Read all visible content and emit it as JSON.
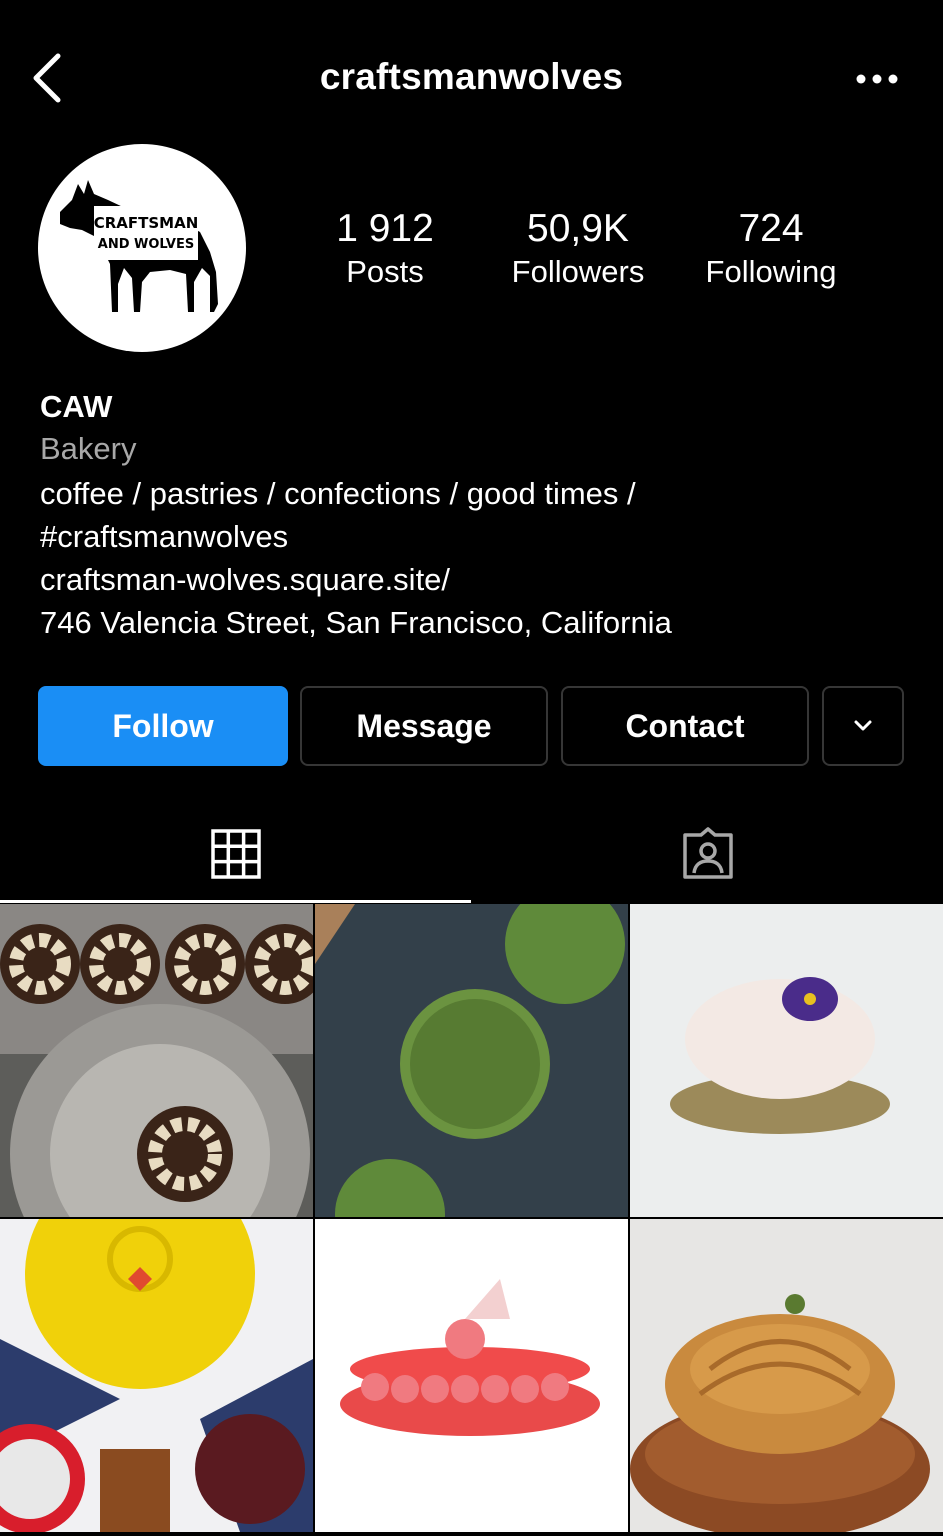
{
  "header": {
    "title": "craftsmanwolves"
  },
  "profile": {
    "logo_text_line1": "CRAFTSMAN",
    "logo_text_line2": "AND WOLVES",
    "stats": [
      {
        "value": "1 912",
        "label": "Posts"
      },
      {
        "value": "50,9K",
        "label": "Followers"
      },
      {
        "value": "724",
        "label": "Following"
      }
    ],
    "name": "CAW",
    "category": "Bakery",
    "bio_line1": "coffee / pastries / confections / good times /",
    "bio_line2": "#craftsmanwolves",
    "link": "craftsman-wolves.square.site/",
    "address": "746 Valencia Street, San Francisco, California"
  },
  "actions": {
    "follow": "Follow",
    "message": "Message",
    "contact": "Contact"
  },
  "tabs": [
    {
      "icon": "grid-icon",
      "active": true
    },
    {
      "icon": "tagged-person-icon",
      "active": false
    }
  ],
  "posts": [
    {
      "subject": "chocolate tart rings with white chocolate twists on a tray"
    },
    {
      "subject": "green pistachio cakes on a slate board"
    },
    {
      "subject": "white mousse dessert with purple violet flower"
    },
    {
      "subject": "yellow glazed cake with heart decorations and tarts"
    },
    {
      "subject": "red macaron with pink piped cream"
    },
    {
      "subject": "pain au chocolat on a wooden stump"
    }
  ],
  "colors": {
    "background": "#000000",
    "follow_button": "#1a8ef5",
    "secondary_text": "#a8a8a8",
    "outline": "#363636"
  }
}
